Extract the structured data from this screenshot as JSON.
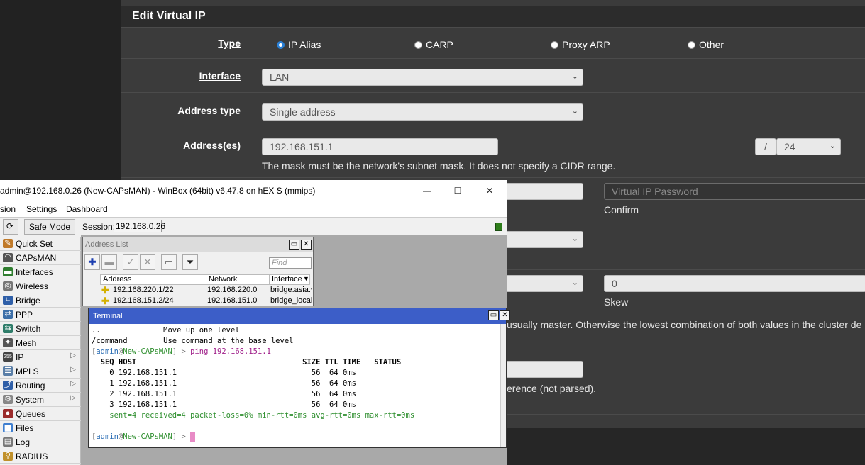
{
  "pfsense": {
    "heading": "Edit Virtual IP",
    "type": {
      "label": "Type",
      "options": [
        {
          "label": "IP Alias",
          "selected": true
        },
        {
          "label": "CARP",
          "selected": false
        },
        {
          "label": "Proxy ARP",
          "selected": false
        },
        {
          "label": "Other",
          "selected": false
        }
      ]
    },
    "interface": {
      "label": "Interface",
      "value": "LAN"
    },
    "address_type": {
      "label": "Address type",
      "value": "Single address"
    },
    "addresses": {
      "label": "Address(es)",
      "value": "192.168.151.1",
      "slash": "/",
      "mask": "24",
      "help": "The mask must be the network's subnet mask. It does not specify a CIDR range."
    },
    "vip_password": {
      "placeholder": "Virtual IP Password",
      "confirm": "Confirm"
    },
    "skew": {
      "value": "0",
      "label": "Skew"
    },
    "advbase_help": "usually master. Otherwise the lowest combination of both values in the cluster de",
    "description_help": "erence (not parsed)."
  },
  "winbox": {
    "title": "admin@192.168.0.26 (New-CAPsMAN) - WinBox (64bit) v6.47.8 on hEX S (mmips)",
    "controls": {
      "minimize": "—",
      "maximize": "☐",
      "close": "✕"
    },
    "menu": [
      "sion",
      "Settings",
      "Dashboard"
    ],
    "toolbar": {
      "undo_icon": "⟳",
      "safe_mode": "Safe Mode",
      "session_label": "Session:",
      "session_value": "192.168.0.26"
    },
    "sidebar": [
      {
        "label": "Quick Set",
        "icon": "quick-set-icon",
        "color": "#c07a2a",
        "glyph": "✎"
      },
      {
        "label": "CAPsMAN",
        "icon": "capsman-icon",
        "color": "#555",
        "glyph": "◠"
      },
      {
        "label": "Interfaces",
        "icon": "interfaces-icon",
        "color": "#2f7d2f",
        "glyph": "▬"
      },
      {
        "label": "Wireless",
        "icon": "wireless-icon",
        "color": "#777",
        "glyph": "◎"
      },
      {
        "label": "Bridge",
        "icon": "bridge-icon",
        "color": "#2f5fa8",
        "glyph": "⌗"
      },
      {
        "label": "PPP",
        "icon": "ppp-icon",
        "color": "#3c6fa8",
        "glyph": "⇄"
      },
      {
        "label": "Switch",
        "icon": "switch-icon",
        "color": "#2f7d6a",
        "glyph": "⇆"
      },
      {
        "label": "Mesh",
        "icon": "mesh-icon",
        "color": "#555",
        "glyph": "✦"
      },
      {
        "label": "IP",
        "icon": "ip-icon",
        "color": "#444",
        "glyph": "255",
        "arrow": "▷"
      },
      {
        "label": "MPLS",
        "icon": "mpls-icon",
        "color": "#5a7fa8",
        "glyph": "☰",
        "arrow": "▷"
      },
      {
        "label": "Routing",
        "icon": "routing-icon",
        "color": "#2f5fa8",
        "glyph": "⤴",
        "arrow": "▷"
      },
      {
        "label": "System",
        "icon": "system-icon",
        "color": "#888",
        "glyph": "⚙",
        "arrow": "▷"
      },
      {
        "label": "Queues",
        "icon": "queues-icon",
        "color": "#9b2b2b",
        "glyph": "●"
      },
      {
        "label": "Files",
        "icon": "files-icon",
        "color": "#3f7fd0",
        "glyph": "▆"
      },
      {
        "label": "Log",
        "icon": "log-icon",
        "color": "#777",
        "glyph": "▤"
      },
      {
        "label": "RADIUS",
        "icon": "radius-icon",
        "color": "#c0902a",
        "glyph": "⚲"
      }
    ],
    "address_list": {
      "title": "Address List",
      "find_placeholder": "Find",
      "columns": [
        "Address",
        "Network",
        "Interface"
      ],
      "rows": [
        {
          "address": "192.168.220.1/22",
          "network": "192.168.220.0",
          "interface": "bridge.asia.v"
        },
        {
          "address": "192.168.151.2/24",
          "network": "192.168.151.0",
          "interface": "bridge_local"
        }
      ]
    },
    "terminal": {
      "title": "Terminal",
      "lines": [
        "..              Move up one level",
        "/command        Use command at the base level"
      ],
      "prompt_user": "admin",
      "prompt_host": "New-CAPsMAN",
      "prompt_open": "[",
      "prompt_at": "@",
      "prompt_close": "] > ",
      "command": "ping 192.168.151.1",
      "table_header": "  SEQ HOST                                     SIZE TTL TIME   STATUS",
      "table_rows": [
        "    0 192.168.151.1                              56  64 0ms",
        "    1 192.168.151.1                              56  64 0ms",
        "    2 192.168.151.1                              56  64 0ms",
        "    3 192.168.151.1                              56  64 0ms"
      ],
      "summary": "    sent=4 received=4 packet-loss=0% min-rtt=0ms avg-rtt=0ms max-rtt=0ms"
    }
  }
}
